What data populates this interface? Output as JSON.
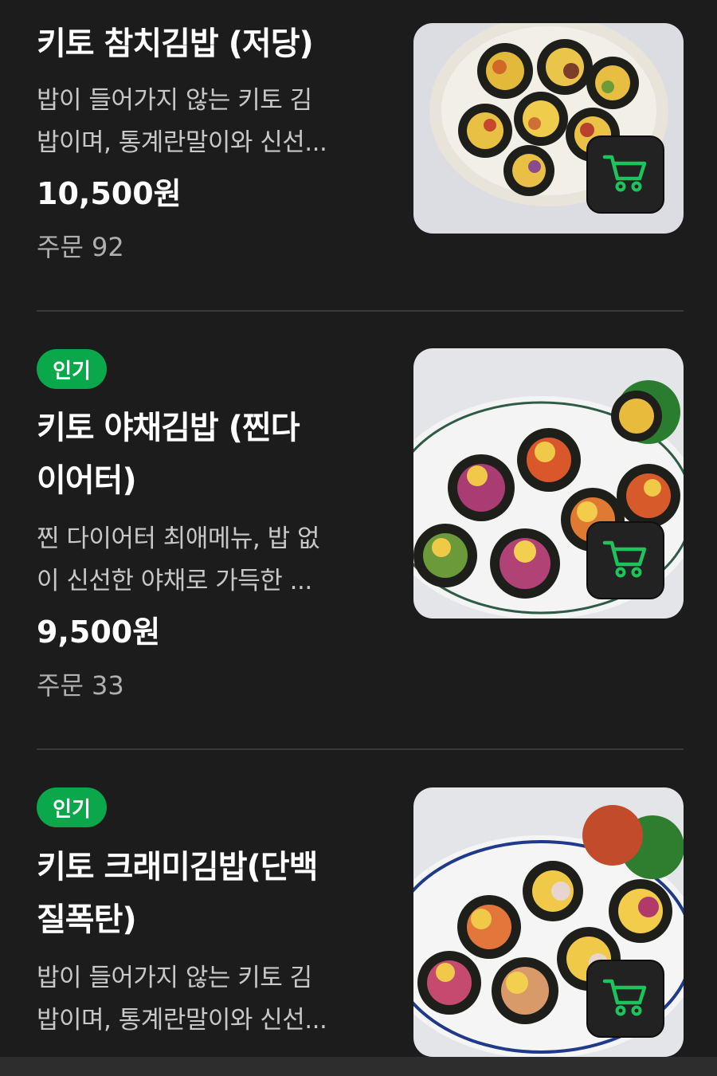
{
  "items": [
    {
      "badge": "",
      "title_lines": [
        "키토 참치김밥 (저당)"
      ],
      "desc_lines": [
        "밥이 들어가지 않는 키토 김",
        "밥이며, 통계란말이와 신선..."
      ],
      "price": "10,500원",
      "orders": "주문 92"
    },
    {
      "badge": "인기",
      "title_lines": [
        "키토 야채김밥 (찐다",
        "이어터)"
      ],
      "desc_lines": [
        "찐 다이어터 최애메뉴, 밥 없",
        "이 신선한 야채로 가득한 ..."
      ],
      "price": "9,500원",
      "orders": "주문 33"
    },
    {
      "badge": "인기",
      "title_lines": [
        "키토 크래미김밥(단백",
        "질폭탄)"
      ],
      "desc_lines": [
        "밥이 들어가지 않는 키토 김",
        "밥이며, 통계란말이와 신선..."
      ],
      "price": "",
      "orders": ""
    }
  ],
  "icons": {
    "cart": "shopping-cart-icon"
  },
  "colors": {
    "background": "#1c1c1c",
    "accent": "#0aa84a",
    "cart_icon": "#1fc35c"
  }
}
